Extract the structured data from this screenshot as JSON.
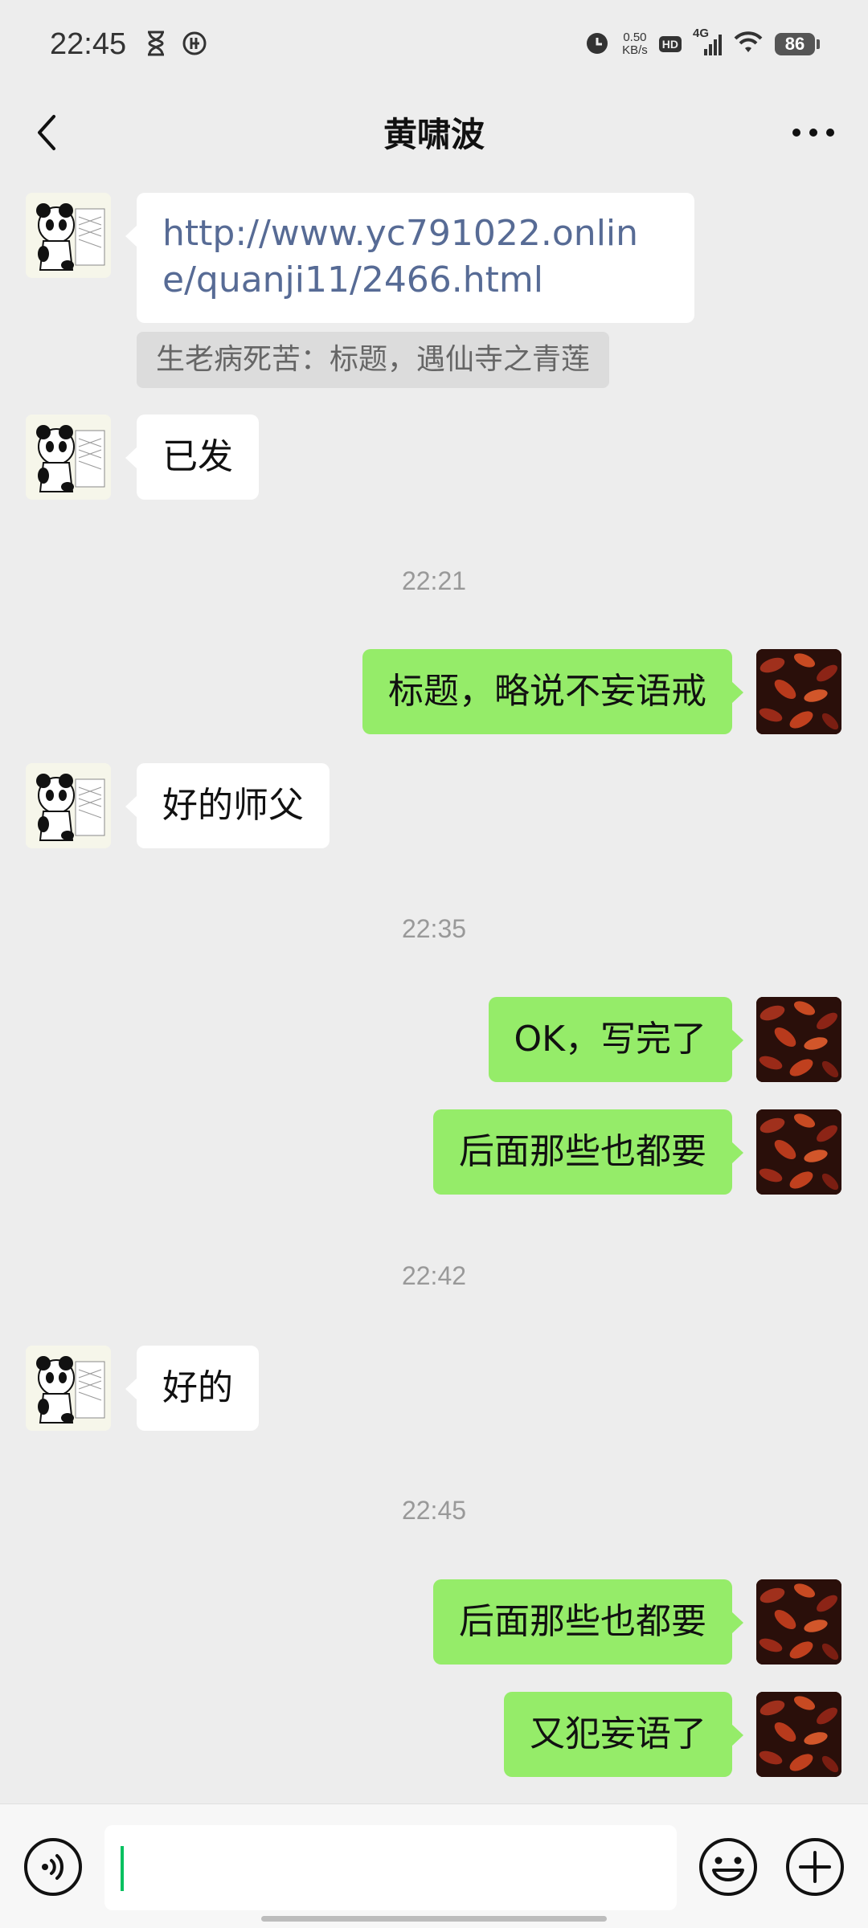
{
  "status_bar": {
    "time": "22:45",
    "net_speed_value": "0.50",
    "net_speed_unit": "KB/s",
    "hd_label": "HD",
    "network_type": "4G",
    "battery": "86",
    "icons": [
      "hourglass-icon",
      "data-saver-icon",
      "alarm-icon",
      "signal-icon",
      "wifi-icon",
      "battery-icon"
    ]
  },
  "header": {
    "title": "黄啸波",
    "back_icon": "chevron-left-icon",
    "more_icon": "more-dots-icon"
  },
  "messages": [
    {
      "side": "left",
      "type": "link",
      "text": "http://www.yc791022.online/quanji11/2466.html"
    },
    {
      "side": "left",
      "type": "quote",
      "text": "生老病死苦：标题，遇仙寺之青莲"
    },
    {
      "side": "left",
      "type": "text",
      "text": "已发"
    },
    {
      "type": "time",
      "text": "22:21"
    },
    {
      "side": "right",
      "type": "text",
      "text": "标题，略说不妄语戒"
    },
    {
      "side": "left",
      "type": "text",
      "text": "好的师父"
    },
    {
      "type": "time",
      "text": "22:35"
    },
    {
      "side": "right",
      "type": "text",
      "text": "OK，写完了"
    },
    {
      "side": "right",
      "type": "text",
      "text": "后面那些也都要"
    },
    {
      "type": "time",
      "text": "22:42"
    },
    {
      "side": "left",
      "type": "text",
      "text": "好的"
    },
    {
      "type": "time",
      "text": "22:45"
    },
    {
      "side": "right",
      "type": "text",
      "text": "后面那些也都要"
    },
    {
      "side": "right",
      "type": "text",
      "text": "又犯妄语了"
    }
  ],
  "input_bar": {
    "value": "",
    "icons": [
      "voice-icon",
      "emoji-icon",
      "plus-icon"
    ]
  },
  "colors": {
    "background": "#ededed",
    "bubble_self": "#95ec69",
    "bubble_other": "#ffffff",
    "link": "#576b95",
    "caret": "#07c160"
  }
}
